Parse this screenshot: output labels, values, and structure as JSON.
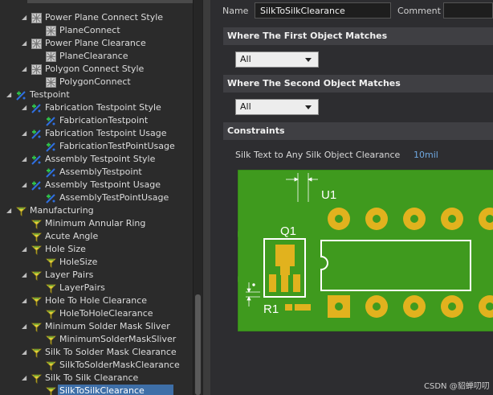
{
  "tree": {
    "items": [
      {
        "label": "Power Plane Connect Style",
        "level": 2,
        "twisty": "open",
        "icon": "plane-rule-icon"
      },
      {
        "label": "PlaneConnect",
        "level": 3,
        "twisty": "",
        "icon": "plane-rule-icon"
      },
      {
        "label": "Power Plane Clearance",
        "level": 2,
        "twisty": "open",
        "icon": "plane-rule-icon"
      },
      {
        "label": "PlaneClearance",
        "level": 3,
        "twisty": "",
        "icon": "plane-rule-icon"
      },
      {
        "label": "Polygon Connect Style",
        "level": 2,
        "twisty": "open",
        "icon": "plane-rule-icon"
      },
      {
        "label": "PolygonConnect",
        "level": 3,
        "twisty": "",
        "icon": "plane-rule-icon"
      },
      {
        "label": "Testpoint",
        "level": 1,
        "twisty": "open",
        "icon": "testpoint-rule-icon"
      },
      {
        "label": "Fabrication Testpoint Style",
        "level": 2,
        "twisty": "open",
        "icon": "testpoint-rule-icon"
      },
      {
        "label": "FabricationTestpoint",
        "level": 3,
        "twisty": "",
        "icon": "testpoint-rule-icon"
      },
      {
        "label": "Fabrication Testpoint Usage",
        "level": 2,
        "twisty": "open",
        "icon": "testpoint-rule-icon"
      },
      {
        "label": "FabricationTestPointUsage",
        "level": 3,
        "twisty": "",
        "icon": "testpoint-rule-icon"
      },
      {
        "label": "Assembly Testpoint Style",
        "level": 2,
        "twisty": "open",
        "icon": "testpoint-rule-icon"
      },
      {
        "label": "AssemblyTestpoint",
        "level": 3,
        "twisty": "",
        "icon": "testpoint-rule-icon"
      },
      {
        "label": "Assembly Testpoint Usage",
        "level": 2,
        "twisty": "open",
        "icon": "testpoint-rule-icon"
      },
      {
        "label": "AssemblyTestPointUsage",
        "level": 3,
        "twisty": "",
        "icon": "testpoint-rule-icon"
      },
      {
        "label": "Manufacturing",
        "level": 1,
        "twisty": "open",
        "icon": "manufacturing-rule-icon"
      },
      {
        "label": "Minimum Annular Ring",
        "level": 2,
        "twisty": "",
        "icon": "manufacturing-rule-icon"
      },
      {
        "label": "Acute Angle",
        "level": 2,
        "twisty": "",
        "icon": "manufacturing-rule-icon"
      },
      {
        "label": "Hole Size",
        "level": 2,
        "twisty": "open",
        "icon": "manufacturing-rule-icon"
      },
      {
        "label": "HoleSize",
        "level": 3,
        "twisty": "",
        "icon": "manufacturing-rule-icon"
      },
      {
        "label": "Layer Pairs",
        "level": 2,
        "twisty": "open",
        "icon": "manufacturing-rule-icon"
      },
      {
        "label": "LayerPairs",
        "level": 3,
        "twisty": "",
        "icon": "manufacturing-rule-icon"
      },
      {
        "label": "Hole To Hole Clearance",
        "level": 2,
        "twisty": "open",
        "icon": "manufacturing-rule-icon"
      },
      {
        "label": "HoleToHoleClearance",
        "level": 3,
        "twisty": "",
        "icon": "manufacturing-rule-icon"
      },
      {
        "label": "Minimum Solder Mask Sliver",
        "level": 2,
        "twisty": "open",
        "icon": "manufacturing-rule-icon"
      },
      {
        "label": "MinimumSolderMaskSliver",
        "level": 3,
        "twisty": "",
        "icon": "manufacturing-rule-icon"
      },
      {
        "label": "Silk To Solder Mask Clearance",
        "level": 2,
        "twisty": "open",
        "icon": "manufacturing-rule-icon"
      },
      {
        "label": "SilkToSolderMaskClearance",
        "level": 3,
        "twisty": "",
        "icon": "manufacturing-rule-icon"
      },
      {
        "label": "Silk To Silk Clearance",
        "level": 2,
        "twisty": "open",
        "icon": "manufacturing-rule-icon"
      },
      {
        "label": "SilkToSilkClearance",
        "level": 3,
        "twisty": "",
        "icon": "manufacturing-rule-icon",
        "selected": true
      }
    ]
  },
  "rule": {
    "name_label": "Name",
    "name_value": "SilkToSilkClearance",
    "comment_label": "Comment",
    "comment_value": "",
    "first_object_header": "Where The First Object Matches",
    "first_object_combo": "All",
    "second_object_header": "Where The Second Object Matches",
    "second_object_combo": "All",
    "constraints_header": "Constraints",
    "constraint_label": "Silk Text to Any Silk Object Clearance",
    "constraint_value": "10mil"
  },
  "preview": {
    "labels": {
      "u1": "U1",
      "q1": "Q1",
      "r1": "R1"
    },
    "colors": {
      "board": "#3f9a1e",
      "pad": "#e1b21e",
      "silk": "#ffffff",
      "hole": "#3f9a1e"
    }
  },
  "watermark": "CSDN @貂蝉叨叨"
}
